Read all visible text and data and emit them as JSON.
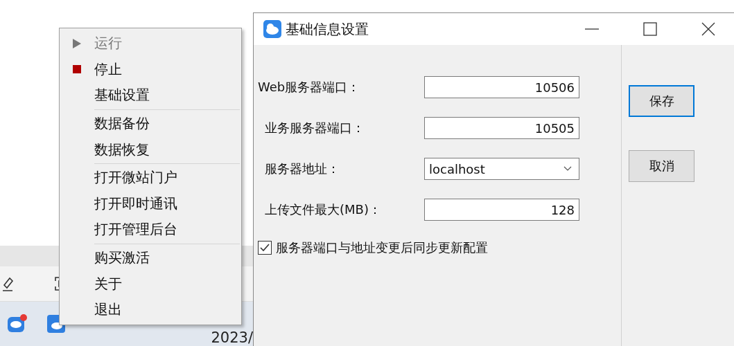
{
  "desktop": {
    "clock": "2023/"
  },
  "context_menu": {
    "groups": [
      [
        {
          "label": "运行",
          "kind": "play",
          "disabled": true
        },
        {
          "label": "停止",
          "kind": "stop",
          "disabled": false
        },
        {
          "label": "基础设置",
          "kind": "plain",
          "disabled": false
        }
      ],
      [
        {
          "label": "数据备份",
          "kind": "plain",
          "disabled": false
        },
        {
          "label": "数据恢复",
          "kind": "plain",
          "disabled": false
        }
      ],
      [
        {
          "label": "打开微站门户",
          "kind": "plain",
          "disabled": false
        },
        {
          "label": "打开即时通讯",
          "kind": "plain",
          "disabled": false
        },
        {
          "label": "打开管理后台",
          "kind": "plain",
          "disabled": false
        }
      ],
      [
        {
          "label": "购买激活",
          "kind": "plain",
          "disabled": false
        },
        {
          "label": "关于",
          "kind": "plain",
          "disabled": false
        },
        {
          "label": "退出",
          "kind": "plain",
          "disabled": false
        }
      ]
    ]
  },
  "dialog": {
    "title": "基础信息设置",
    "fields": [
      {
        "label": "Web服务器端口：",
        "value": "10506",
        "kind": "number"
      },
      {
        "label": "业务服务器端口：",
        "value": "10505",
        "kind": "number"
      },
      {
        "label": "服务器地址：",
        "value": "localhost",
        "kind": "select"
      },
      {
        "label": "上传文件最大(MB)：",
        "value": "128",
        "kind": "number"
      }
    ],
    "sync_option": {
      "label": "服务器端口与地址变更后同步更新配置",
      "checked": true
    },
    "buttons": [
      {
        "label": "保存",
        "focused": true
      },
      {
        "label": "取消",
        "focused": false
      }
    ]
  }
}
